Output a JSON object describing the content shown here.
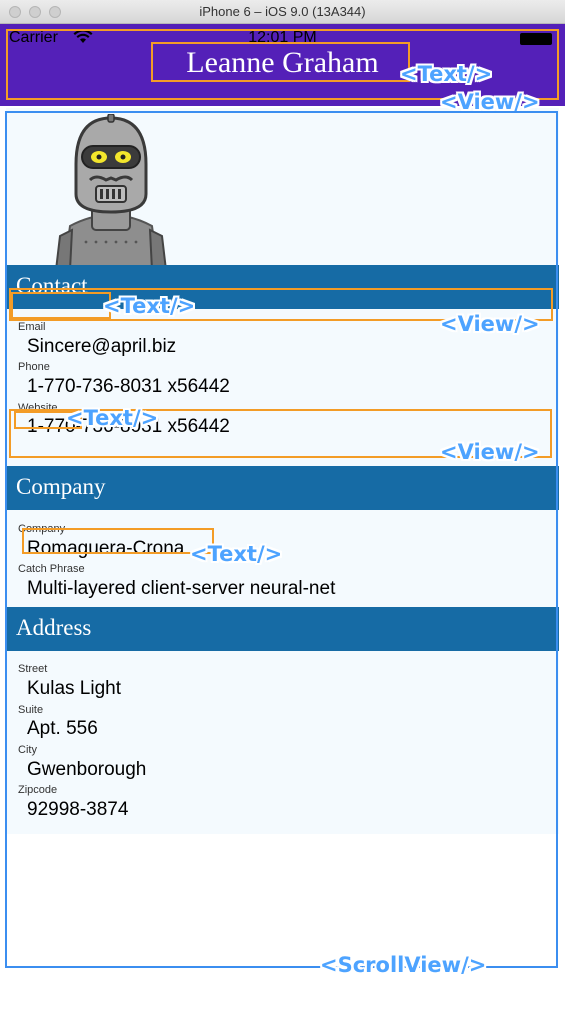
{
  "window": {
    "title": "iPhone 6 – iOS 9.0 (13A344)"
  },
  "statusbar": {
    "carrier": "Carrier",
    "time": "12:01 PM"
  },
  "nav": {
    "title": "Leanne Graham"
  },
  "sections": {
    "contact": {
      "title": "Contact"
    },
    "company": {
      "title": "Company"
    },
    "address": {
      "title": "Address"
    }
  },
  "contact": {
    "email_label": "Email",
    "email": "Sincere@april.biz",
    "phone_label": "Phone",
    "phone": "1-770-736-8031 x56442",
    "website_label": "Website",
    "website": "1-770-736-8031 x56442"
  },
  "company": {
    "name_label": "Company",
    "name": "Romaguera-Crona",
    "catch_label": "Catch Phrase",
    "catch": "Multi-layered client-server neural-net"
  },
  "address": {
    "street_label": "Street",
    "street": "Kulas Light",
    "suite_label": "Suite",
    "suite": "Apt. 556",
    "city_label": "City",
    "city": "Gwenborough",
    "zip_label": "Zipcode",
    "zip": "92998-3874"
  },
  "overlay_tags": {
    "text": "<Text/>",
    "view": "<View/>",
    "scrollview": "<ScrollView/>"
  },
  "colors": {
    "navbar": "#5420b8",
    "section_header": "#166ba5",
    "content_bg": "#f4fafe",
    "overlay_orange": "#f39c27",
    "overlay_blue": "#3b8ef0"
  },
  "icons": [
    "wifi-icon",
    "battery-icon",
    "robot-avatar-icon"
  ]
}
